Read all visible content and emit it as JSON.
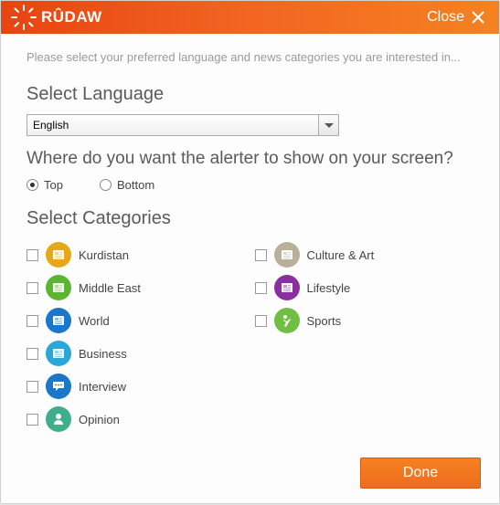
{
  "header": {
    "brand": "RÛDAW",
    "close_label": "Close"
  },
  "instruction": "Please select your preferred language and news categories you are interested in...",
  "language": {
    "title": "Select Language",
    "selected": "English"
  },
  "alerter": {
    "question": "Where do you want the alerter to show on your screen?",
    "options": [
      {
        "label": "Top",
        "checked": true
      },
      {
        "label": "Bottom",
        "checked": false
      }
    ]
  },
  "categories": {
    "title": "Select Categories",
    "left": [
      {
        "label": "Kurdistan",
        "color": "#e6a817",
        "icon": "news"
      },
      {
        "label": "Middle East",
        "color": "#5cb531",
        "icon": "news"
      },
      {
        "label": "World",
        "color": "#1a77c9",
        "icon": "news"
      },
      {
        "label": "Business",
        "color": "#2aa7d9",
        "icon": "news"
      },
      {
        "label": "Interview",
        "color": "#1a77c9",
        "icon": "speech"
      },
      {
        "label": "Opinion",
        "color": "#3fae8a",
        "icon": "opinion"
      }
    ],
    "right": [
      {
        "label": "Culture & Art",
        "color": "#b8b09b",
        "icon": "news"
      },
      {
        "label": "Lifestyle",
        "color": "#8a2fa0",
        "icon": "news"
      },
      {
        "label": "Sports",
        "color": "#6fbf44",
        "icon": "sports"
      }
    ]
  },
  "footer": {
    "done_label": "Done"
  },
  "colors": {
    "accent_orange": "#f26522"
  }
}
